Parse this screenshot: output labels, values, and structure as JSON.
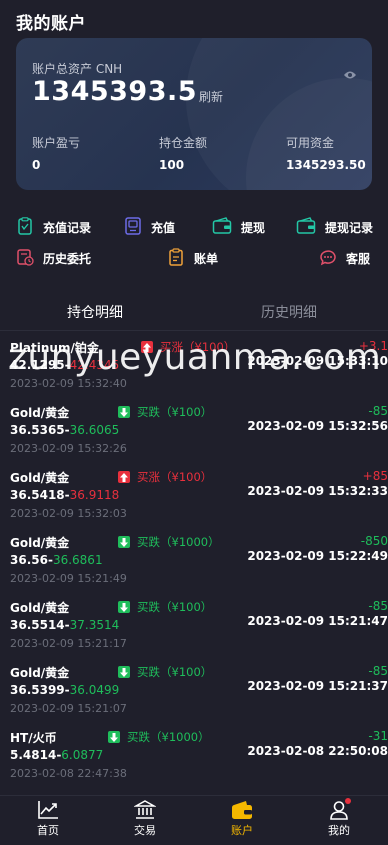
{
  "header": {
    "title": "我的账户"
  },
  "account": {
    "total_label": "账户总资产 CNH",
    "total_value": "1345393.5",
    "refresh_label": "刷新",
    "stats": [
      {
        "label": "账户盈亏",
        "value": "0"
      },
      {
        "label": "持仓金额",
        "value": "100"
      },
      {
        "label": "可用资金",
        "value": "1345293.50"
      }
    ]
  },
  "menu": [
    {
      "label": "充值记录",
      "icon": "recharge-record-icon"
    },
    {
      "label": "充值",
      "icon": "recharge-icon"
    },
    {
      "label": "提现",
      "icon": "withdraw-icon"
    },
    {
      "label": "提现记录",
      "icon": "withdraw-record-icon"
    },
    {
      "label": "历史委托",
      "icon": "history-order-icon"
    },
    {
      "label": "账单",
      "icon": "bill-icon"
    },
    {
      "label": "客服",
      "icon": "customer-service-icon"
    }
  ],
  "tabs": {
    "holdings": "持仓明细",
    "history": "历史明细"
  },
  "watermark": "zunyueyuanma.com",
  "orders": [
    {
      "name": "Platinum/铂金",
      "open_price": "42.1295",
      "close_price": "42.4345",
      "open_time": "2023-02-09 15:32:40",
      "direction": "up",
      "direction_label": "买涨（¥100）",
      "pl": "+3.1",
      "close_time": "2023-02-09 15:33:10"
    },
    {
      "name": "Gold/黄金",
      "open_price": "36.5365",
      "close_price": "36.6065",
      "open_time": "2023-02-09 15:32:26",
      "direction": "down",
      "direction_label": "买跌（¥100）",
      "pl": "-85",
      "close_time": "2023-02-09 15:32:56"
    },
    {
      "name": "Gold/黄金",
      "open_price": "36.5418",
      "close_price": "36.9118",
      "open_time": "2023-02-09 15:32:03",
      "direction": "up",
      "direction_label": "买涨（¥100）",
      "pl": "+85",
      "close_time": "2023-02-09 15:32:33"
    },
    {
      "name": "Gold/黄金",
      "open_price": "36.56",
      "close_price": "36.6861",
      "open_time": "2023-02-09 15:21:49",
      "direction": "down",
      "direction_label": "买跌（¥1000）",
      "pl": "-850",
      "close_time": "2023-02-09 15:22:49"
    },
    {
      "name": "Gold/黄金",
      "open_price": "36.5514",
      "close_price": "37.3514",
      "open_time": "2023-02-09 15:21:17",
      "direction": "down",
      "direction_label": "买跌（¥100）",
      "pl": "-85",
      "close_time": "2023-02-09 15:21:47"
    },
    {
      "name": "Gold/黄金",
      "open_price": "36.5399",
      "close_price": "36.0499",
      "open_time": "2023-02-09 15:21:07",
      "direction": "down",
      "direction_label": "买跌（¥100）",
      "pl": "-85",
      "close_time": "2023-02-09 15:21:37"
    },
    {
      "name": "HT/火币",
      "open_price": "5.4814",
      "close_price": "6.0877",
      "open_time": "2023-02-08 22:47:38",
      "direction": "down",
      "direction_label": "买跌（¥1000）",
      "pl": "-31",
      "close_time": "2023-02-08 22:50:08"
    }
  ],
  "tabbar": [
    {
      "label": "首页",
      "icon": "home-chart-icon"
    },
    {
      "label": "交易",
      "icon": "bank-icon"
    },
    {
      "label": "账户",
      "icon": "wallet-icon"
    },
    {
      "label": "我的",
      "icon": "user-icon"
    }
  ],
  "colors": {
    "up": "#e8303d",
    "down": "#1fbd5b",
    "active_tab": "#f5b800",
    "background": "#1f1f2b"
  }
}
